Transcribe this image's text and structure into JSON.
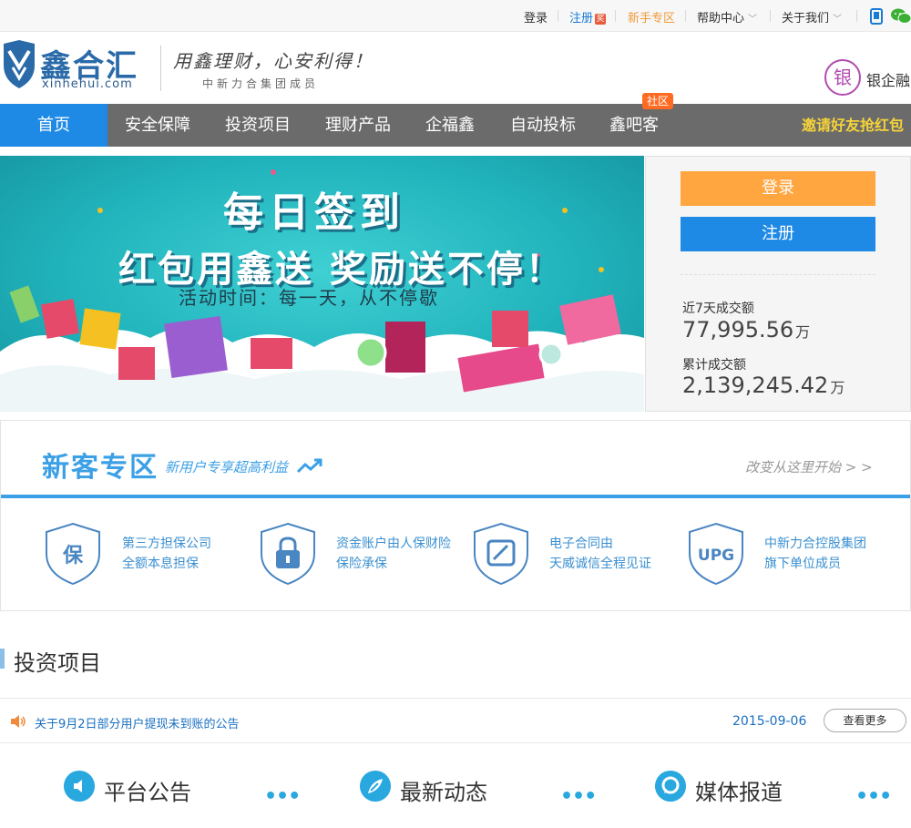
{
  "topbar": {
    "login": "登录",
    "register": "注册",
    "register_badge": "奖",
    "newbie": "新手专区",
    "help": "帮助中心",
    "about": "关于我们"
  },
  "header": {
    "logo_name": "鑫合汇",
    "logo_url": "xinhehui.com",
    "slogan": "用鑫理财，心安利得！",
    "slogan_sub": "中新力合集团成员",
    "partner_icon_text": "银",
    "partner_name": "银企融"
  },
  "nav": {
    "items": [
      {
        "label": "首页"
      },
      {
        "label": "安全保障"
      },
      {
        "label": "投资项目"
      },
      {
        "label": "理财产品"
      },
      {
        "label": "企福鑫"
      },
      {
        "label": "自动投标"
      },
      {
        "label": "鑫吧客"
      }
    ],
    "community_badge": "社区",
    "invite": "邀请好友抢红包"
  },
  "banner": {
    "title": "每日签到",
    "subtitle": "红包用鑫送 奖励送不停！",
    "time": "活动时间：每一天，从不停歇"
  },
  "panel": {
    "login_button": "登录",
    "register_button": "注册",
    "week_label": "近7天成交额",
    "week_value": "77,995.56",
    "week_unit": "万",
    "total_label": "累计成交额",
    "total_value": "2,139,245.42",
    "total_unit": "万"
  },
  "newbie_zone": {
    "title": "新客专区",
    "subtitle": "新用户专享超高利益",
    "more": "改变从这里开始 > >",
    "features": [
      {
        "icon": "保",
        "line1": "第三方担保公司",
        "line2": "全额本息担保"
      },
      {
        "icon": "lock",
        "line1": "资金账户由人保财险",
        "line2": "保险承保"
      },
      {
        "icon": "contract",
        "line1": "电子合同由",
        "line2": "天威诚信全程见证"
      },
      {
        "icon": "UPG",
        "line1": "中新力合控股集团",
        "line2": "旗下单位成员"
      }
    ]
  },
  "investment": {
    "title": "投资项目"
  },
  "notice": {
    "text": "关于9月2日部分用户提现未到账的公告",
    "date": "2015-09-06",
    "more_button": "查看更多"
  },
  "news": {
    "columns": [
      {
        "label": "平台公告"
      },
      {
        "label": "最新动态"
      },
      {
        "label": "媒体报道"
      }
    ],
    "dots": "•••"
  },
  "colors": {
    "brand_blue": "#1f8ae6",
    "login_orange": "#ffa640",
    "nav_gray": "#6b6b6b",
    "banner_teal": "#21b4bc"
  }
}
